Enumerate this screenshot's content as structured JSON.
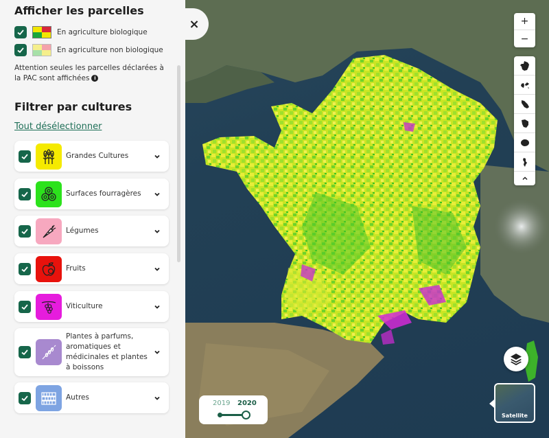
{
  "panel": {
    "title": "Afficher les parcelles",
    "legend": [
      {
        "label": "En agriculture biologique",
        "colors": [
          "#f2e600",
          "#d8283a",
          "#1aa63a",
          "#f2e600"
        ]
      },
      {
        "label": "En agriculture non biologique",
        "colors": [
          "#f5ef8c",
          "#f4a3ab",
          "#a7e0a8",
          "#f5ef8c"
        ]
      }
    ],
    "note": "Attention seules les parcelles déclarées à la PAC sont affichées",
    "filter_title": "Filtrer par cultures",
    "deselect_label": "Tout désélectionner",
    "close_label": "×",
    "info_label": "i",
    "cultures": [
      {
        "label": "Grandes Cultures",
        "color": "#f5ea00",
        "icon": "wheat-icon"
      },
      {
        "label": "Surfaces fourragères",
        "color": "#2ce21c",
        "icon": "hay-bales-icon"
      },
      {
        "label": "Légumes",
        "color": "#f7a8bf",
        "icon": "carrot-icon"
      },
      {
        "label": "Fruits",
        "color": "#e8120c",
        "icon": "apple-icon"
      },
      {
        "label": "Viticulture",
        "color": "#e61cdd",
        "icon": "grapes-icon"
      },
      {
        "label": "Plantes à parfums, aromatiques et médicinales et plantes à boissons",
        "color": "#a889cf",
        "icon": "lavender-icon"
      },
      {
        "label": "Autres",
        "color": "#7ea4e2",
        "icon": "grid-icon"
      }
    ]
  },
  "map_controls": {
    "zoom_in": "+",
    "zoom_out": "−",
    "territories": [
      "metropole-icon",
      "guadeloupe-icon",
      "martinique-icon",
      "guyane-icon",
      "reunion-icon",
      "mayotte-icon"
    ],
    "collapse": "chevron-up-icon"
  },
  "basemap": {
    "label": "Satellite"
  },
  "years": {
    "options": [
      "2019",
      "2020"
    ],
    "selected": "2020"
  }
}
